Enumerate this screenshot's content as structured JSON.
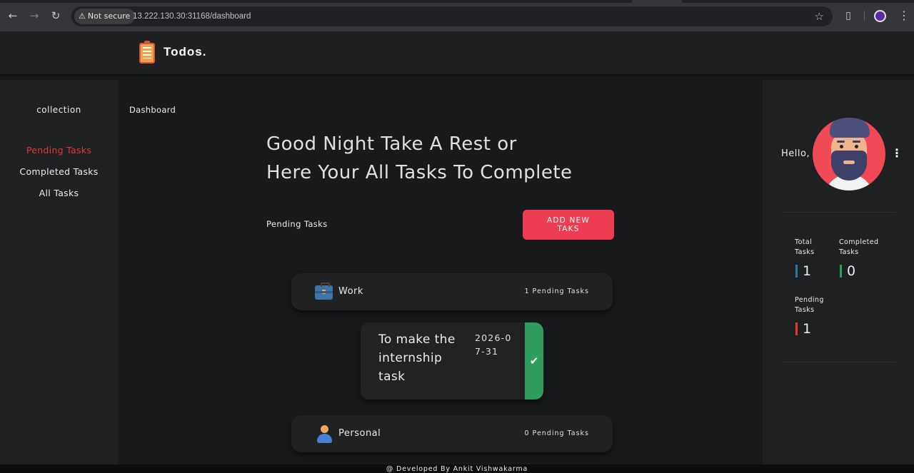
{
  "browser": {
    "security_label": "Not secure",
    "url": "13.222.130.30:31168/dashboard"
  },
  "app": {
    "title": "Todos."
  },
  "sidebar": {
    "collection_title": "collection",
    "items": [
      {
        "label": "Pending Tasks",
        "active": true
      },
      {
        "label": "Completed Tasks",
        "active": false
      },
      {
        "label": "All Tasks",
        "active": false
      }
    ]
  },
  "main": {
    "breadcrumb": "Dashboard",
    "greeting_line1": "Good Night Take A Rest or",
    "greeting_line2": "Here Your All Tasks To Complete",
    "section_title": "Pending Tasks",
    "add_button": "ADD NEW TAKS",
    "categories": [
      {
        "name": "Work",
        "icon": "briefcase-icon",
        "count_label": "1 Pending Tasks"
      },
      {
        "name": "Personal",
        "icon": "person-icon",
        "count_label": "0 Pending Tasks"
      }
    ],
    "tasks": [
      {
        "title": "To make the internship task",
        "date": "2026-07-31",
        "status_color": "#2e9d5d"
      }
    ]
  },
  "profile": {
    "greeting": "Hello,",
    "stats": [
      {
        "label": "Total Tasks",
        "value": "1",
        "color": "#2a7a9a"
      },
      {
        "label": "Completed Tasks",
        "value": "0",
        "color": "#2e9d5d"
      },
      {
        "label": "Pending Tasks",
        "value": "1",
        "color": "#e53935"
      }
    ]
  },
  "footer": {
    "text": "@ Developed By Ankit Vishwakarma"
  },
  "colors": {
    "accent": "#ee3d52",
    "active_link": "#e53935",
    "complete": "#2e9d5d"
  }
}
